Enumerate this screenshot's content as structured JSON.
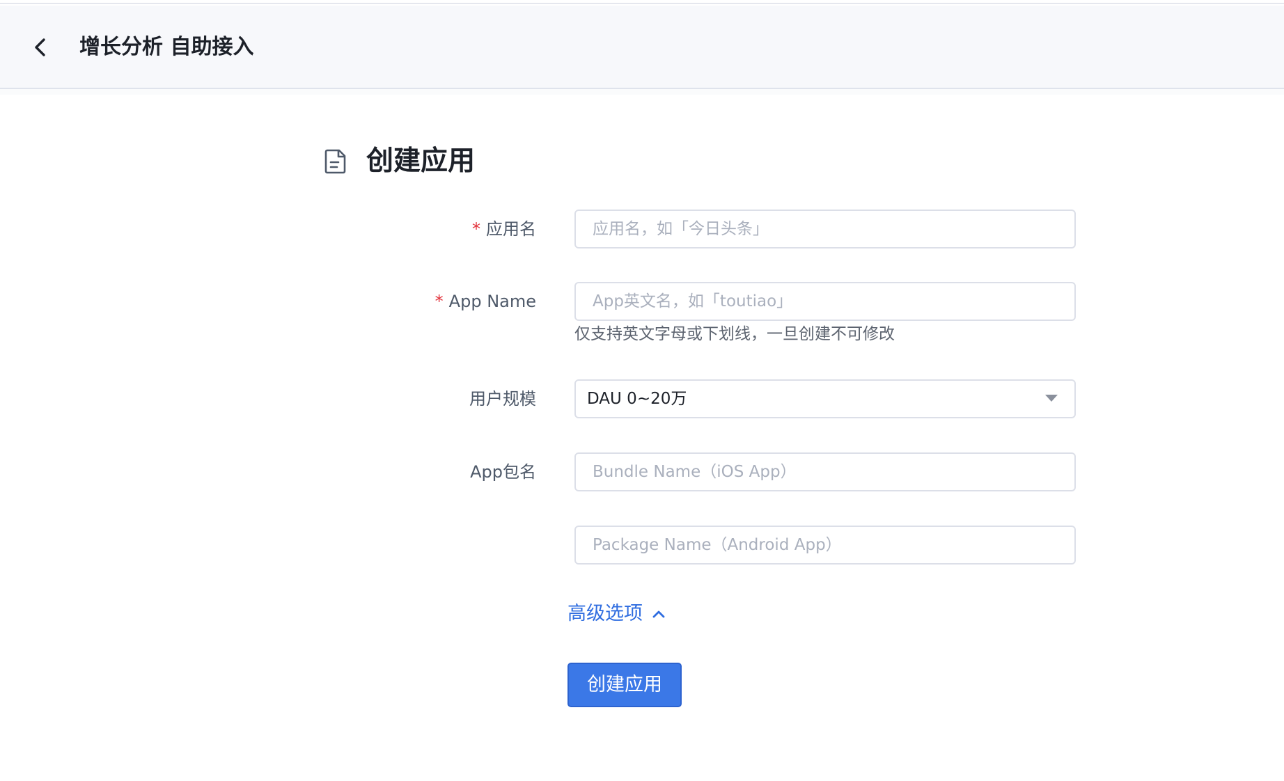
{
  "header": {
    "title": "增长分析 自助接入",
    "back_icon": "chevron-left-icon"
  },
  "page": {
    "title": "创建应用",
    "title_icon": "document-icon"
  },
  "form": {
    "app_name": {
      "label": "应用名",
      "required_mark": "*",
      "placeholder": "应用名，如「今日头条」",
      "value": ""
    },
    "app_name_en": {
      "label": "App Name",
      "required_mark": "*",
      "placeholder": "App英文名，如「toutiao」",
      "value": "",
      "hint": "仅支持英文字母或下划线，一旦创建不可修改"
    },
    "user_scale": {
      "label": "用户规模",
      "selected": "DAU 0~20万",
      "caret_icon": "caret-down-icon"
    },
    "bundle": {
      "label": "App包名",
      "ios_placeholder": "Bundle Name（iOS App）",
      "android_placeholder": "Package Name（Android App）"
    },
    "advanced": {
      "label": "高级选项",
      "icon": "chevron-up-icon",
      "expanded": true
    },
    "submit_label": "创建应用"
  },
  "colors": {
    "primary": "#3b78e7",
    "link": "#2f6de0",
    "required": "#e2323b",
    "header_bg": "#f7f8fb"
  }
}
